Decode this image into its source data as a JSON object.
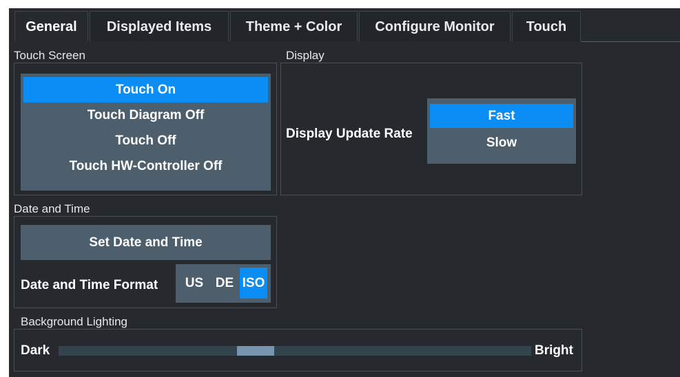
{
  "tabs": [
    {
      "label": "General",
      "active": true
    },
    {
      "label": "Displayed Items",
      "active": false
    },
    {
      "label": "Theme + Color",
      "active": false
    },
    {
      "label": "Configure Monitor",
      "active": false
    },
    {
      "label": "Touch",
      "active": false
    }
  ],
  "touch_screen": {
    "title": "Touch Screen",
    "options": [
      "Touch On",
      "Touch Diagram Off",
      "Touch Off",
      "Touch HW-Controller Off"
    ],
    "selected": "Touch On"
  },
  "display": {
    "title": "Display",
    "update_rate_label": "Display Update Rate",
    "update_rate_options": [
      "Fast",
      "Slow"
    ],
    "selected": "Fast"
  },
  "date_time": {
    "title": "Date and Time",
    "set_button": "Set Date and Time",
    "format_label": "Date and Time Format",
    "format_options": [
      "US",
      "DE",
      "ISO"
    ],
    "selected": "ISO"
  },
  "background_lighting": {
    "title": "Background Lighting",
    "min_label": "Dark",
    "max_label": "Bright",
    "level_fraction": 0.41
  },
  "colors": {
    "accent": "#0a8ef5",
    "panel_bg": "#262a2f",
    "control_bg": "#4d5e6c"
  }
}
